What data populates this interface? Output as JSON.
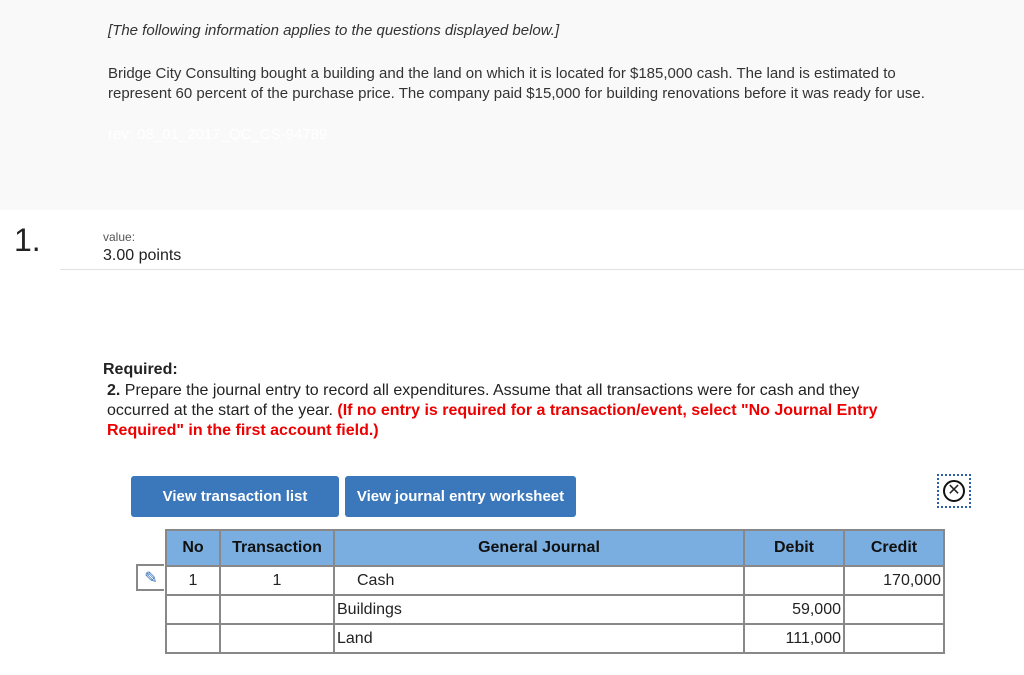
{
  "intro": "[The following information applies to the questions displayed below.]",
  "paragraph": "Bridge City Consulting bought a building and the land on which it is located for $185,000 cash. The land is estimated to represent 60 percent of the purchase price. The company paid $15,000 for building renovations before it was ready for use.",
  "rev": "rev: 08_01_2017_QC_CS-94789",
  "question": {
    "number": "1.",
    "value_label": "value:",
    "points": "3.00 points"
  },
  "required": {
    "heading": "Required:",
    "num": "2.",
    "text": "Prepare the journal entry to record all expenditures. Assume that all transactions were for cash and they occurred at the start of the year.",
    "note": "(If no entry is required for a transaction/event, select \"No Journal Entry Required\" in the first account field.)"
  },
  "buttons": {
    "transactions": "View transaction list",
    "worksheet": "View journal entry worksheet"
  },
  "table": {
    "headers": [
      "No",
      "Transaction",
      "General Journal",
      "Debit",
      "Credit"
    ],
    "rows": [
      {
        "no": "1",
        "transaction": "1",
        "account": "Cash",
        "debit": "",
        "credit": "170,000"
      },
      {
        "no": "",
        "transaction": "",
        "account": "Buildings",
        "debit": "59,000",
        "credit": ""
      },
      {
        "no": "",
        "transaction": "",
        "account": "Land",
        "debit": "111,000",
        "credit": ""
      }
    ]
  }
}
